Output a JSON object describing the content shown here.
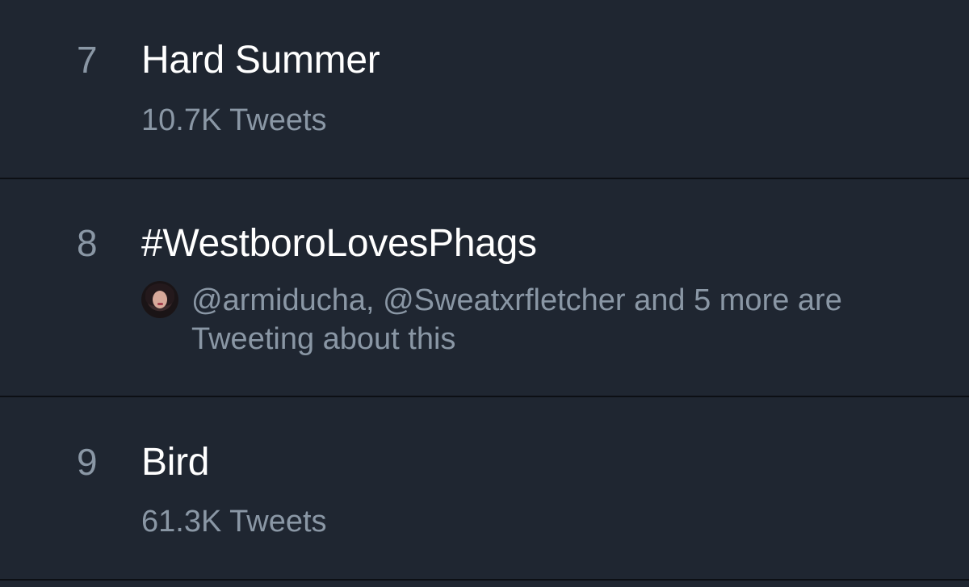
{
  "trends": [
    {
      "rank": "7",
      "title": "Hard Summer",
      "meta": "10.7K Tweets"
    },
    {
      "rank": "8",
      "title": "#WestboroLovesPhags",
      "context_line_1": "@armiducha, @Sweatxrfletcher and 5 more are",
      "context_line_2": "Tweeting about this"
    },
    {
      "rank": "9",
      "title": "Bird",
      "meta": "61.3K Tweets"
    }
  ],
  "colors": {
    "background": "#1f2631",
    "title": "#ffffff",
    "secondary": "#8a97a5",
    "divider": "#0c0f14"
  }
}
